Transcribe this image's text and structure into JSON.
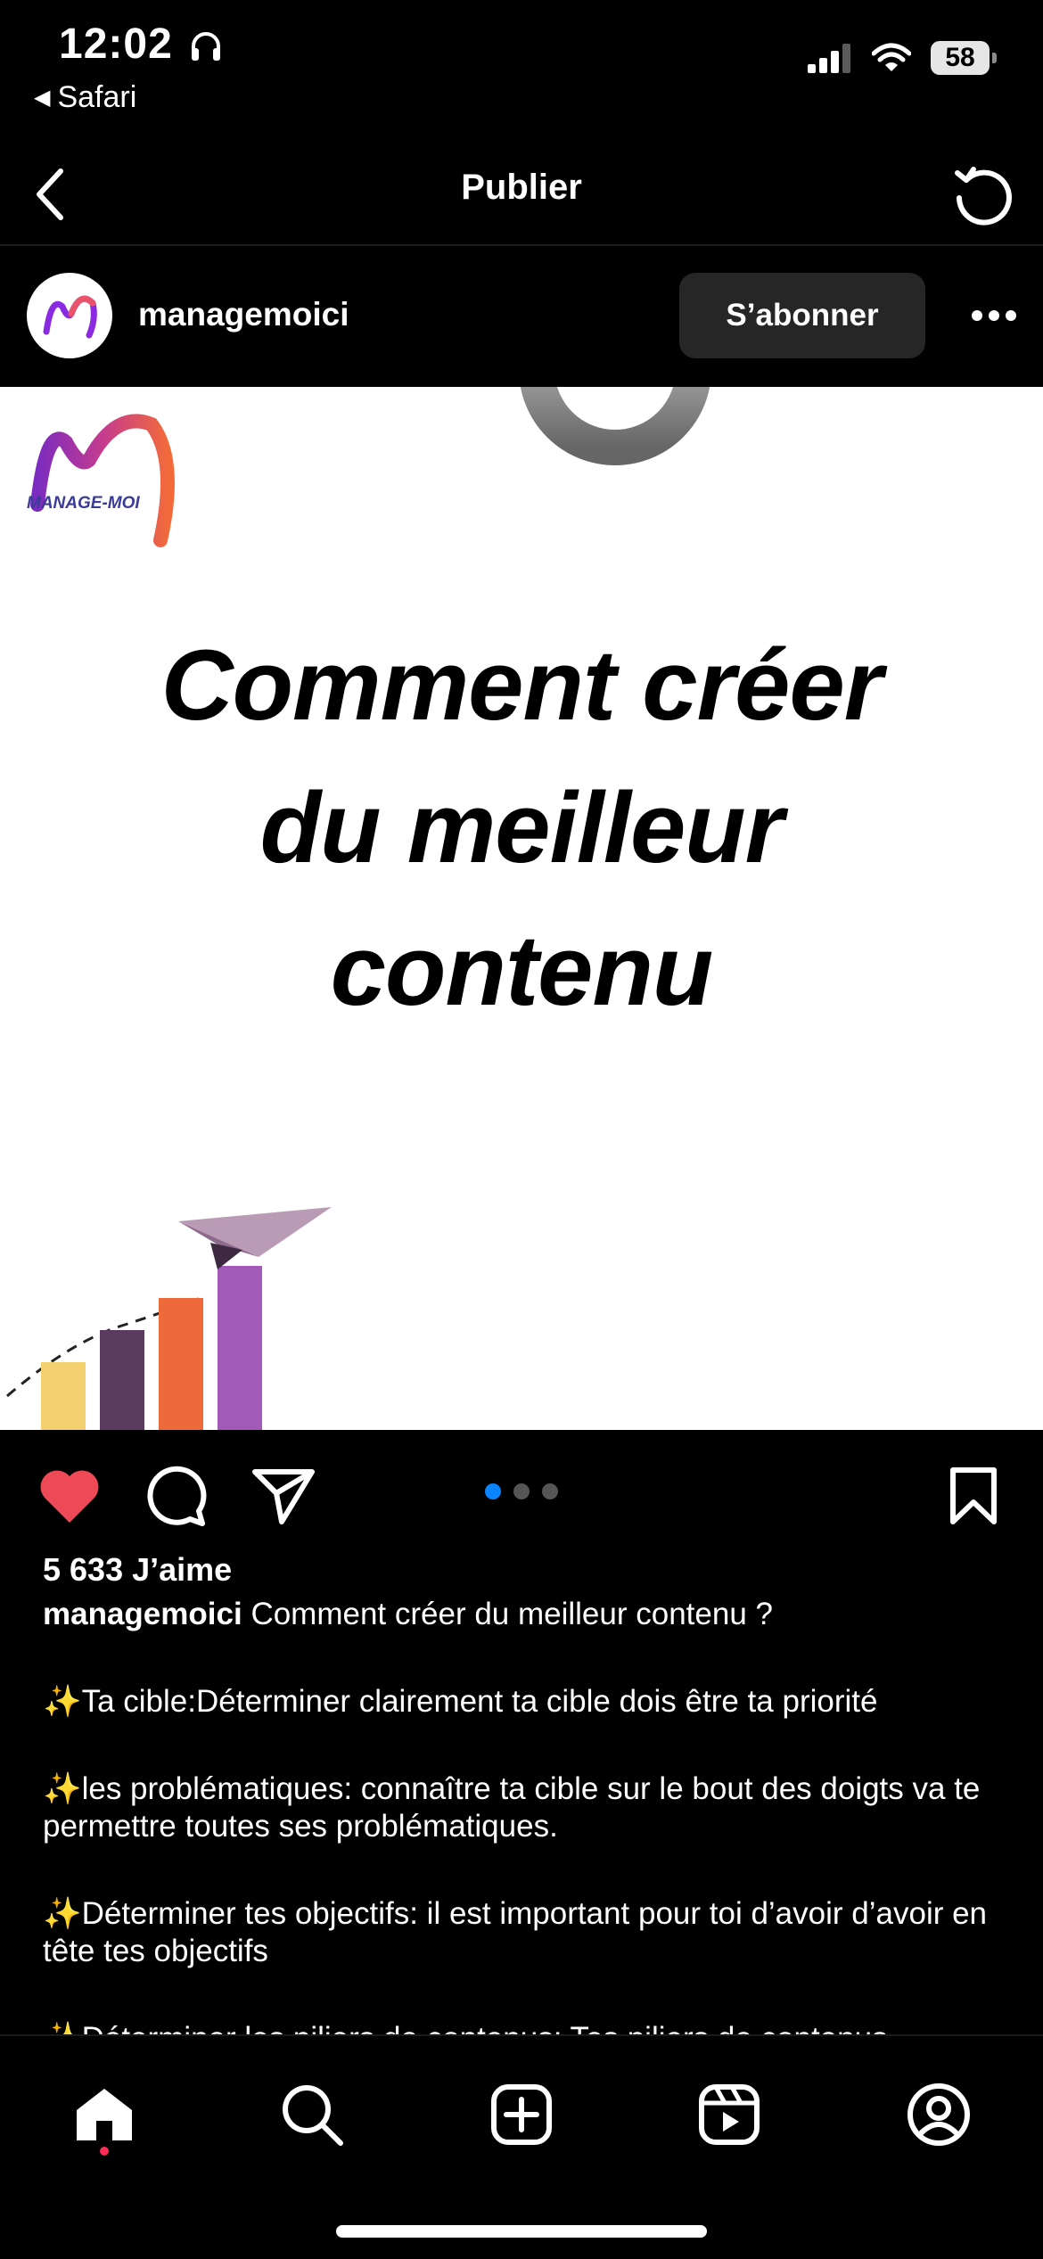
{
  "status_bar": {
    "time": "12:02",
    "back_app": "Safari",
    "battery": "58"
  },
  "nav": {
    "title": "Publier"
  },
  "post": {
    "username": "managemoici",
    "follow_label": "S’abonner",
    "logo_text": "MANAGE-MOI",
    "headline_lines": [
      "Comment créer",
      "du meilleur",
      "contenu"
    ],
    "carousel": {
      "current": 1,
      "total": 3
    },
    "likes": "5 633 J’aime",
    "caption": {
      "username": "managemoici",
      "intro": "Comment créer du meilleur contenu ?",
      "points": [
        "✨Ta cible:Déterminer clairement ta cible dois être ta priorité",
        "✨les problématiques: connaître ta cible sur le bout des doigts va te permettre toutes ses problématiques.",
        "✨Déterminer tes objectifs: il est important pour toi d’avoir d’avoir en tête tes objectifs",
        "✨Déterminer les piliers de contenus: Tes piliers de contenus"
      ]
    }
  },
  "colors": {
    "like_active": "#ed4956",
    "carousel_active": "#0a84ff",
    "chart_bars": [
      "#f5d06f",
      "#5a3a5e",
      "#ee6a3b",
      "#a25bb8"
    ]
  },
  "icons": {
    "nav": [
      "chevron-left-icon",
      "refresh-icon"
    ],
    "actions": [
      "heart-icon",
      "comment-icon",
      "share-icon",
      "bookmark-icon"
    ],
    "tabs": [
      "home-icon",
      "search-icon",
      "create-icon",
      "reels-icon",
      "profile-icon"
    ]
  }
}
